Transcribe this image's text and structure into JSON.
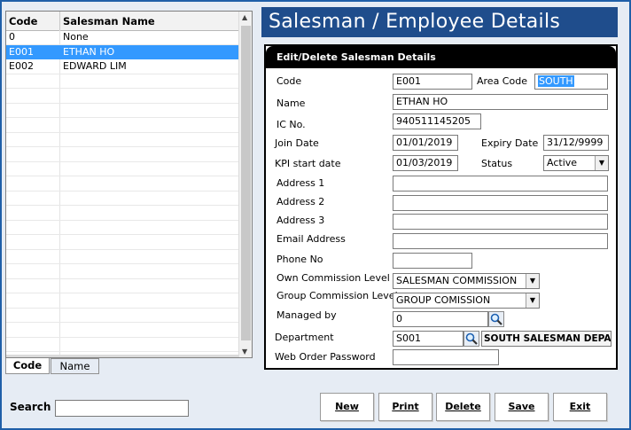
{
  "title": "Salesman / Employee Details",
  "grid": {
    "col_code": "Code",
    "col_name": "Salesman Name",
    "rows": [
      {
        "code": "0",
        "name": "None"
      },
      {
        "code": "E001",
        "name": "ETHAN HO"
      },
      {
        "code": "E002",
        "name": "EDWARD LIM"
      }
    ],
    "selected_index": 1
  },
  "tabs": [
    "Code",
    "Name"
  ],
  "panel": {
    "header": "Edit/Delete Salesman Details",
    "code_label": "Code",
    "code_value": "E001",
    "area_label": "Area Code",
    "area_value": "SOUTH",
    "name_label": "Name",
    "name_value": "ETHAN HO",
    "ic_label": "IC No.",
    "ic_value": "940511145205",
    "join_label": "Join Date",
    "join_value": "01/01/2019",
    "expiry_label": "Expiry Date",
    "expiry_value": "31/12/9999",
    "kpi_label": "KPI start date",
    "kpi_value": "01/03/2019",
    "status_label": "Status",
    "status_value": "Active",
    "addr1_label": "Address 1",
    "addr1_value": "",
    "addr2_label": "Address 2",
    "addr2_value": "",
    "addr3_label": "Address 3",
    "addr3_value": "",
    "email_label": "Email Address",
    "email_value": "",
    "phone_label": "Phone No",
    "phone_value": "",
    "own_comm_label": "Own Commission Level",
    "own_comm_value": "SALESMAN COMMISSION",
    "group_comm_label": "Group Commission Level",
    "group_comm_value": "GROUP COMISSION",
    "managed_label": "Managed by",
    "managed_value": "0",
    "dept_label": "Department",
    "dept_value": "S001",
    "dept_name": "SOUTH SALESMAN DEPARTM",
    "web_label": "Web Order Password",
    "web_value": ""
  },
  "buttons": {
    "new": "New",
    "print": "Print",
    "delete": "Delete",
    "save": "Save",
    "exit": "Exit"
  },
  "search": {
    "label": "Search",
    "value": ""
  },
  "colors": {
    "selected_row": "#3399ff",
    "title_bg": "#1f4d8c",
    "frame": "#1f5fa8"
  }
}
